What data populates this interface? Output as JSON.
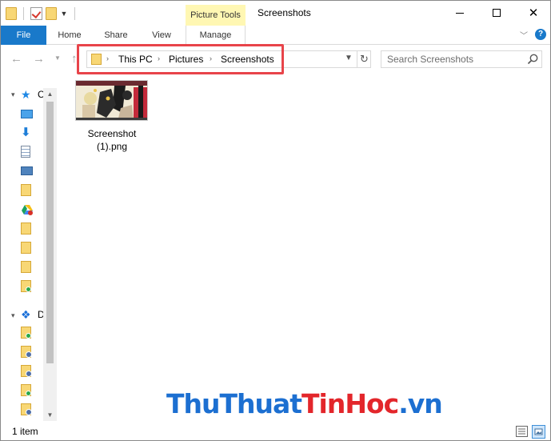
{
  "window": {
    "title": "Screenshots",
    "context_tab_group": "Picture Tools"
  },
  "ribbon": {
    "tabs": [
      "File",
      "Home",
      "Share",
      "View",
      "Manage"
    ]
  },
  "address": {
    "crumbs": [
      "This PC",
      "Pictures",
      "Screenshots"
    ]
  },
  "search": {
    "placeholder": "Search Screenshots"
  },
  "nav_pane": {
    "quick_access_label": "C",
    "dropbox_label": "D"
  },
  "files": [
    {
      "name_line1": "Screenshot",
      "name_line2": "(1).png"
    }
  ],
  "status": {
    "count": "1 item"
  },
  "watermark": {
    "part1": "ThuThuat",
    "part2": "TinHoc",
    "part3": ".vn"
  },
  "colors": {
    "accent": "#1979ca",
    "picture_tools_bg": "#fff7b3",
    "highlight": "#e8444a"
  }
}
